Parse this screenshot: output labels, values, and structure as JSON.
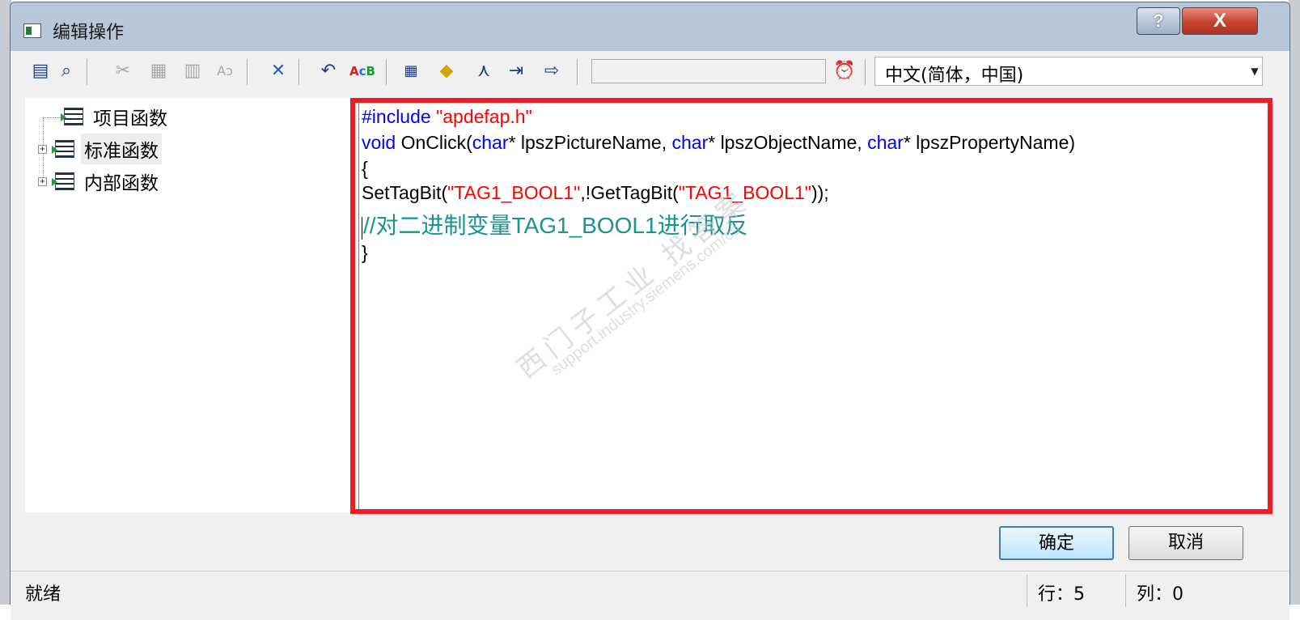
{
  "window": {
    "title": "编辑操作",
    "help_label": "?",
    "close_label": "X"
  },
  "toolbar": {
    "icons": [
      "save-icon",
      "find-icon",
      "cut-icon",
      "copy-icon",
      "paste-icon",
      "replace-icon",
      "delete-icon",
      "undo-icon",
      "abc-icon",
      "counter-icon",
      "cube-icon",
      "compass-icon",
      "import-icon",
      "export-icon",
      "timer-icon"
    ],
    "search_value": "",
    "language": "中文(简体，中国)"
  },
  "tree": {
    "items": [
      {
        "label": "项目函数",
        "expandable": false
      },
      {
        "label": "标准函数",
        "expandable": true,
        "selected": true
      },
      {
        "label": "内部函数",
        "expandable": true
      }
    ]
  },
  "editor": {
    "line1": {
      "kw": "#include",
      "str": "\"apdefap.h\""
    },
    "line2": {
      "kw1": "void",
      "t1": " OnClick(",
      "kw2": "char",
      "t2": "* lpszPictureName, ",
      "kw3": "char",
      "t3": "* lpszObjectName, ",
      "kw4": "char",
      "t4": "* lpszPropertyName)"
    },
    "line3": "{",
    "line4": {
      "t1": "SetTagBit(",
      "s1": "\"TAG1_BOOL1\"",
      "t2": ",!GetTagBit(",
      "s2": "\"TAG1_BOOL1\"",
      "t3": "));"
    },
    "line5": "//对二进制变量TAG1_BOOL1进行取反",
    "line6": "}",
    "watermark_cn": "西门子工业 找答案",
    "watermark_url": "support.industry.siemens.com/cs"
  },
  "buttons": {
    "ok": "确定",
    "cancel": "取消"
  },
  "statusbar": {
    "status": "就绪",
    "row": "行：5",
    "col": "列：0"
  },
  "colors": {
    "highlight_border": "#ee1c25",
    "keyword": "#0000ff",
    "string": "#ff0000",
    "comment": "#1a9391"
  }
}
